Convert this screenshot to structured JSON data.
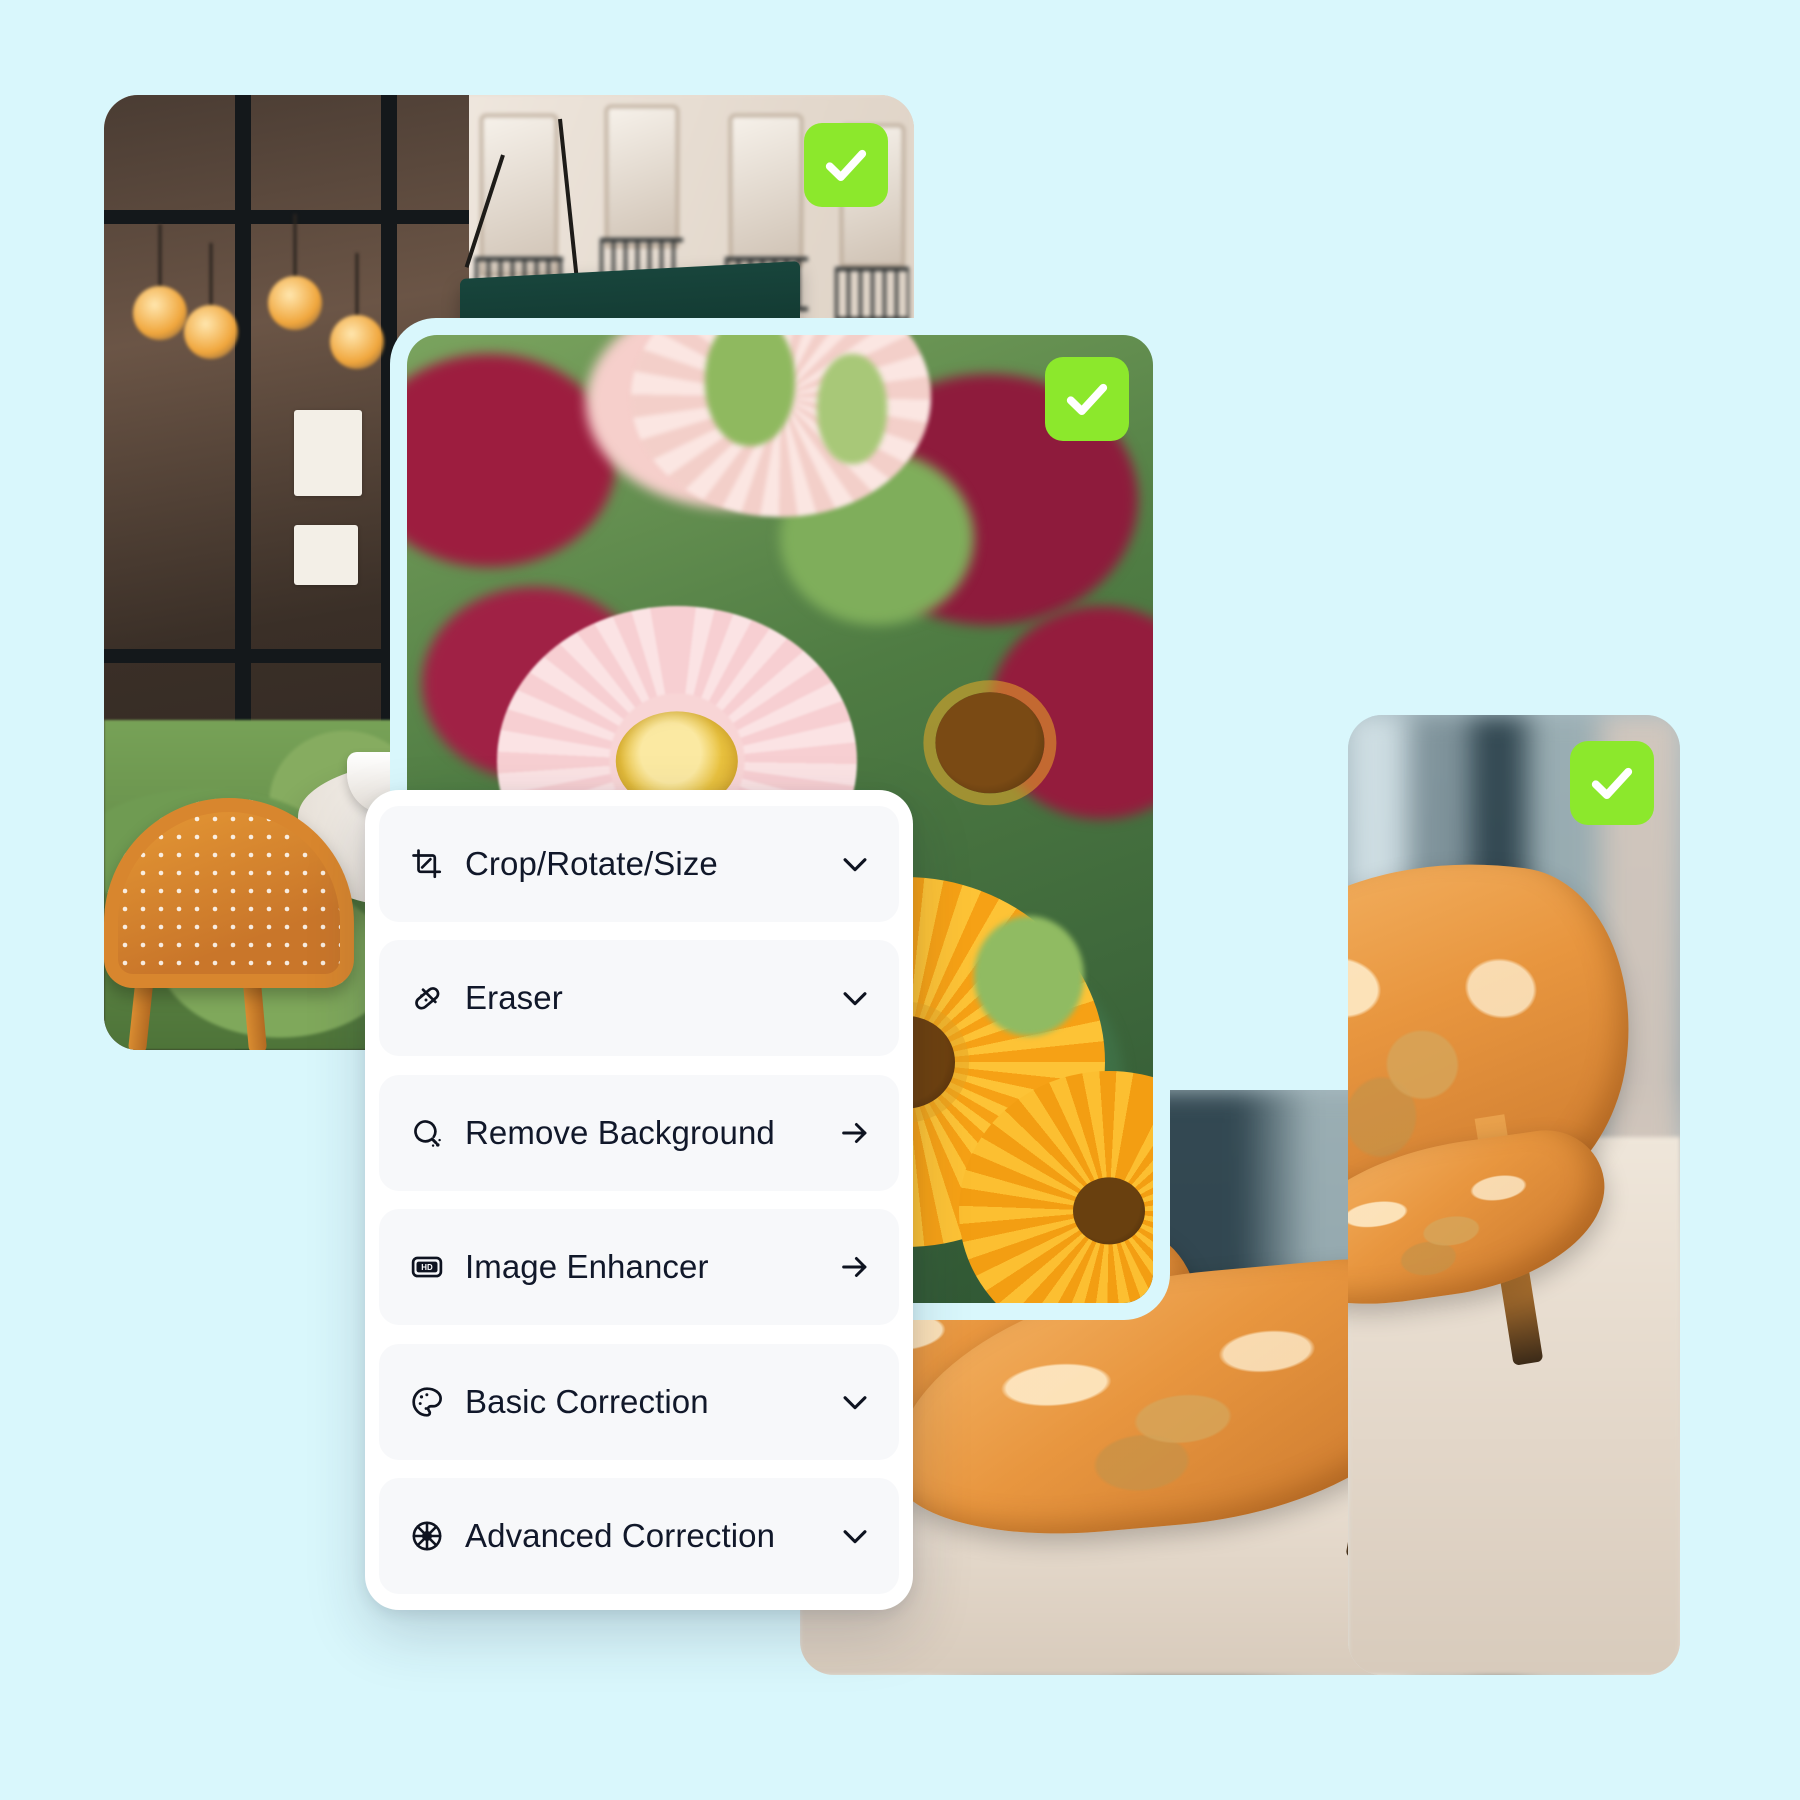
{
  "theme": {
    "background_color": "#d9f7fc",
    "card_frame_color": "#d9f7fc",
    "badge_green": "#8ce82c",
    "menu_background": "#ffffff",
    "menu_row_background": "#f7f8fa",
    "menu_text_color": "#11182a"
  },
  "photos": [
    {
      "name": "paris-cafe-storefront",
      "alt": "Paris café storefront with green awning, wicker chair and table",
      "selected": true,
      "badge_icon": "check-icon"
    },
    {
      "name": "gerbera-flower-bouquet",
      "alt": "Close-up of pink and yellow gerbera daisies",
      "selected": true,
      "badge_icon": "check-icon"
    },
    {
      "name": "orange-high-heel-shoe",
      "alt": "Orange satin embroidered high heel pump",
      "selected": true,
      "badge_icon": "check-icon"
    }
  ],
  "tools_menu": {
    "items": [
      {
        "label": "Crop/Rotate/Size",
        "icon": "crop-icon",
        "affordance": "chevron-down-icon"
      },
      {
        "label": "Eraser",
        "icon": "eraser-icon",
        "affordance": "chevron-down-icon"
      },
      {
        "label": "Remove Background",
        "icon": "magic-wand-icon",
        "affordance": "arrow-right-icon"
      },
      {
        "label": "Image Enhancer",
        "icon": "hd-icon",
        "affordance": "arrow-right-icon"
      },
      {
        "label": "Basic Correction",
        "icon": "palette-icon",
        "affordance": "chevron-down-icon"
      },
      {
        "label": "Advanced Correction",
        "icon": "sliders-icon",
        "affordance": "chevron-down-icon"
      }
    ]
  }
}
